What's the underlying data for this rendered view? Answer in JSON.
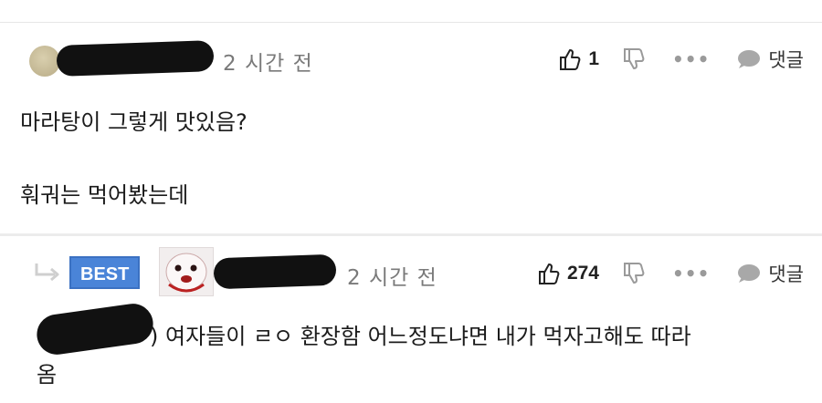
{
  "comments": [
    {
      "time": "2 시간 전",
      "likes": "1",
      "more": "•••",
      "reply_label": "댓글",
      "lines": [
        "마라탕이 그렇게 맛있음?",
        "훠궈는 먹어봤는데"
      ]
    },
    {
      "badge": "BEST",
      "time": "2 시간 전",
      "likes": "274",
      "more": "•••",
      "reply_label": "댓글",
      "line1_tail": ") 여자들이 ㄹㅇ 환장함 어느정도냐면 내가 먹자고해도 따라",
      "line2": "옴"
    }
  ]
}
